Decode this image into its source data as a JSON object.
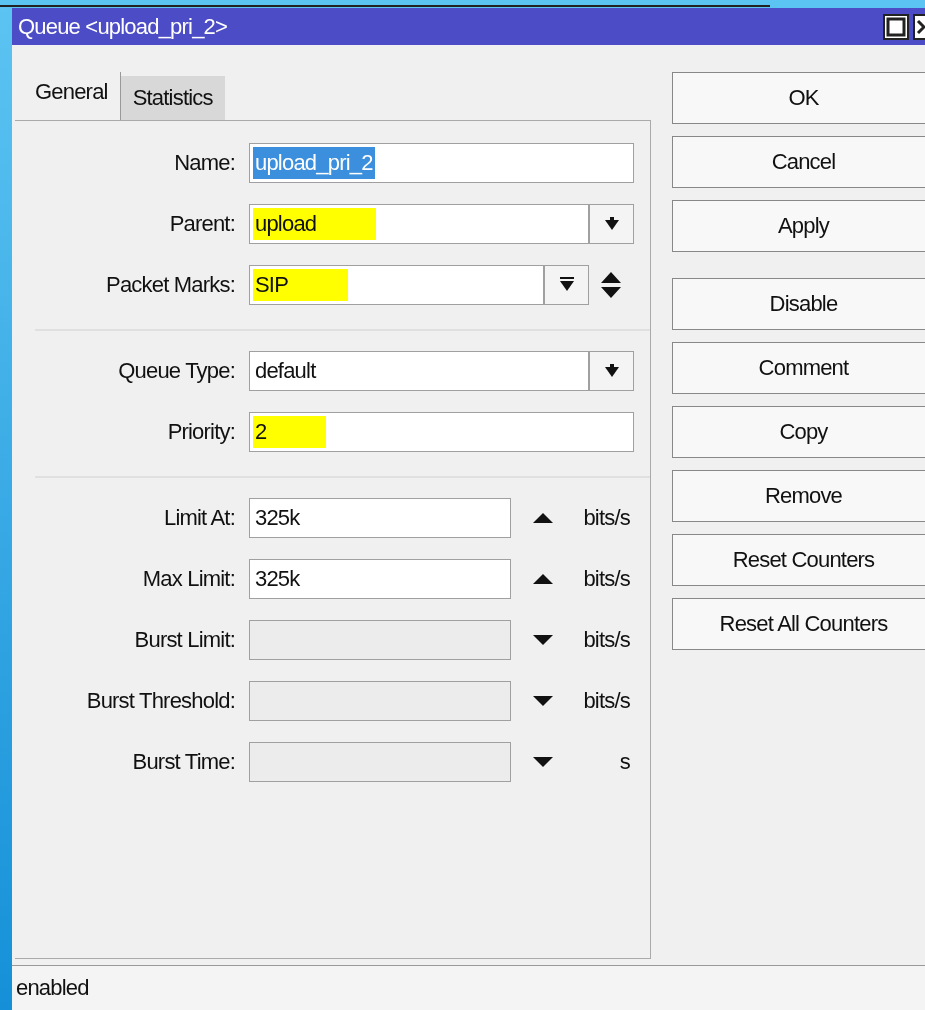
{
  "window": {
    "title": "Queue <upload_pri_2>"
  },
  "tabs": [
    {
      "label": "General",
      "selected": true
    },
    {
      "label": "Statistics",
      "selected": false
    }
  ],
  "groups": [
    {
      "fields": [
        {
          "label": "Name:",
          "kind": "text",
          "value": "upload_pri_2",
          "selected": true,
          "highlighted": false
        },
        {
          "label": "Parent:",
          "kind": "dropdown",
          "value": "upload",
          "selected": false,
          "highlighted": true
        },
        {
          "label": "Packet Marks:",
          "kind": "multi",
          "value": "SIP",
          "selected": false,
          "highlighted": true
        }
      ]
    },
    {
      "fields": [
        {
          "label": "Queue Type:",
          "kind": "dropdown",
          "value": "default",
          "selected": false,
          "highlighted": false
        },
        {
          "label": "Priority:",
          "kind": "text",
          "value": "2",
          "selected": false,
          "highlighted": true
        }
      ]
    },
    {
      "fields": [
        {
          "label": "Limit At:",
          "kind": "rate",
          "value": "325k",
          "expanded": true,
          "disabled": false,
          "unit": "bits/s"
        },
        {
          "label": "Max Limit:",
          "kind": "rate",
          "value": "325k",
          "expanded": true,
          "disabled": false,
          "unit": "bits/s"
        },
        {
          "label": "Burst Limit:",
          "kind": "rate",
          "expanded": false,
          "disabled": true,
          "unit": "bits/s"
        },
        {
          "label": "Burst Threshold:",
          "kind": "rate",
          "expanded": false,
          "disabled": true,
          "unit": "bits/s"
        },
        {
          "label": "Burst Time:",
          "kind": "rate",
          "expanded": false,
          "disabled": true,
          "unit": "s"
        }
      ]
    }
  ],
  "button_groups": [
    [
      "OK",
      "Cancel",
      "Apply"
    ],
    [
      "Disable",
      "Comment",
      "Copy",
      "Remove",
      "Reset Counters",
      "Reset All Counters"
    ]
  ],
  "status_bar": {
    "text": "enabled"
  }
}
